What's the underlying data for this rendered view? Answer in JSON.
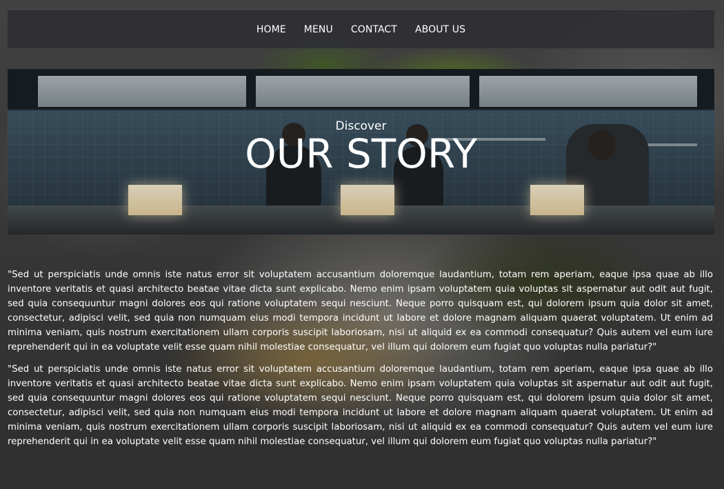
{
  "nav": {
    "items": [
      {
        "label": "HOME"
      },
      {
        "label": "MENU"
      },
      {
        "label": "CONTACT"
      },
      {
        "label": "ABOUT US"
      }
    ]
  },
  "hero": {
    "subtitle": "Discover",
    "title": "OUR STORY"
  },
  "content": {
    "paragraphs": [
      "\"Sed ut perspiciatis unde omnis iste natus error sit voluptatem accusantium doloremque laudantium, totam rem aperiam, eaque ipsa quae ab illo inventore veritatis et quasi architecto beatae vitae dicta sunt explicabo. Nemo enim ipsam voluptatem quia voluptas sit aspernatur aut odit aut fugit, sed quia consequuntur magni dolores eos qui ratione voluptatem sequi nesciunt. Neque porro quisquam est, qui dolorem ipsum quia dolor sit amet, consectetur, adipisci velit, sed quia non numquam eius modi tempora incidunt ut labore et dolore magnam aliquam quaerat voluptatem. Ut enim ad minima veniam, quis nostrum exercitationem ullam corporis suscipit laboriosam, nisi ut aliquid ex ea commodi consequatur? Quis autem vel eum iure reprehenderit qui in ea voluptate velit esse quam nihil molestiae consequatur, vel illum qui dolorem eum fugiat quo voluptas nulla pariatur?\"",
      "\"Sed ut perspiciatis unde omnis iste natus error sit voluptatem accusantium doloremque laudantium, totam rem aperiam, eaque ipsa quae ab illo inventore veritatis et quasi architecto beatae vitae dicta sunt explicabo. Nemo enim ipsam voluptatem quia voluptas sit aspernatur aut odit aut fugit, sed quia consequuntur magni dolores eos qui ratione voluptatem sequi nesciunt. Neque porro quisquam est, qui dolorem ipsum quia dolor sit amet, consectetur, adipisci velit, sed quia non numquam eius modi tempora incidunt ut labore et dolore magnam aliquam quaerat voluptatem. Ut enim ad minima veniam, quis nostrum exercitationem ullam corporis suscipit laboriosam, nisi ut aliquid ex ea commodi consequatur? Quis autem vel eum iure reprehenderit qui in ea voluptate velit esse quam nihil molestiae consequatur, vel illum qui dolorem eum fugiat quo voluptas nulla pariatur?\""
    ]
  }
}
